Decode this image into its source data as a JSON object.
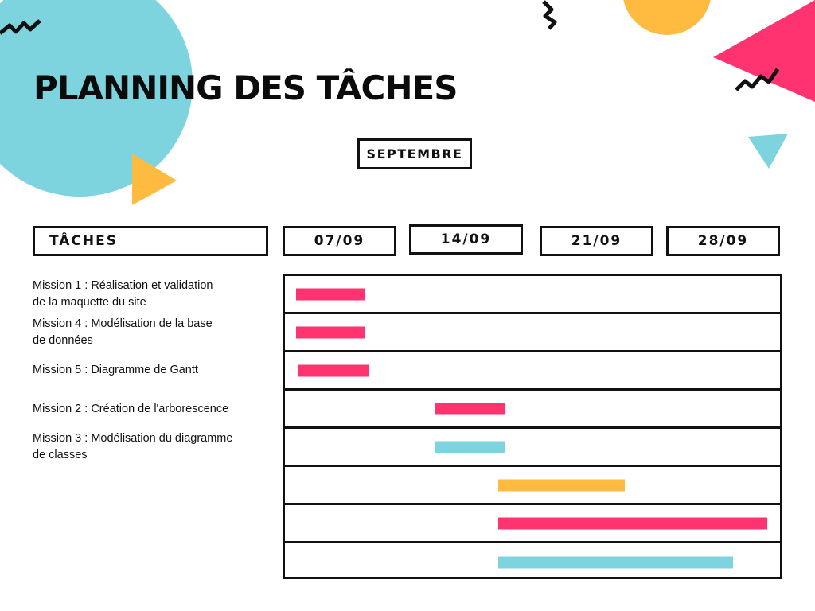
{
  "title": "PLANNING DES TÂCHES",
  "month": "SEPTEMBRE",
  "tasks_header": "TÂCHES",
  "colors": {
    "pink": "#FF3370",
    "blue": "#7DD3DE",
    "yellow": "#FFBB40",
    "ink": "#111111"
  },
  "chart_data": {
    "type": "gantt",
    "x_ticks": [
      "07/09",
      "14/09",
      "21/09",
      "28/09"
    ],
    "tasks": [
      {
        "label": "Mission 1 : Réalisation et validation\nde la maquette du site",
        "start": 0.0,
        "end": 0.55,
        "color": "pink"
      },
      {
        "label": "Mission 4 : Modélisation de la base\nde données",
        "start": 0.0,
        "end": 0.55,
        "color": "pink"
      },
      {
        "label": "Mission 5 : Diagramme de Gantt",
        "start": 0.02,
        "end": 0.57,
        "color": "pink"
      },
      {
        "label": "Mission 2 : Création de l'arborescence",
        "start": 1.1,
        "end": 1.65,
        "color": "pink"
      },
      {
        "label": "Mission 3 : Modélisation du diagramme\nde classes",
        "start": 1.1,
        "end": 1.65,
        "color": "blue"
      },
      {
        "label": "",
        "start": 1.6,
        "end": 2.6,
        "color": "yellow"
      },
      {
        "label": "",
        "start": 1.6,
        "end": 3.75,
        "color": "pink"
      },
      {
        "label": "",
        "start": 1.6,
        "end": 3.45,
        "color": "blue"
      }
    ]
  }
}
